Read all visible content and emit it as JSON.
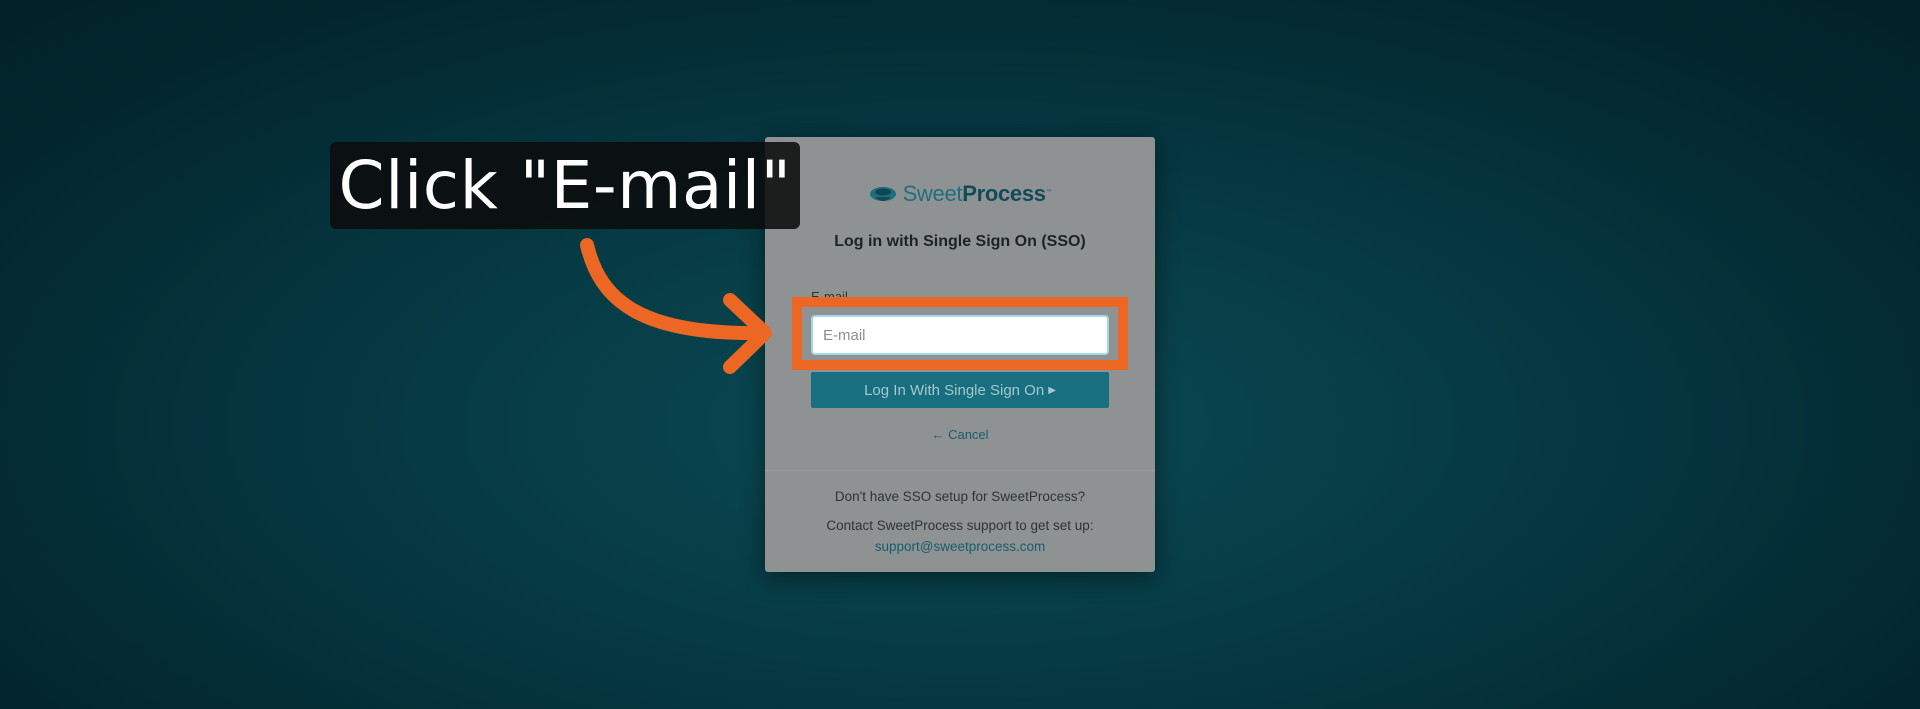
{
  "colors": {
    "accent_orange": "#ec6624",
    "brand_teal": "#176f80",
    "brand_dark": "#114b58",
    "background": "#063a44"
  },
  "callout": {
    "text": "Click \"E-mail\""
  },
  "login_card": {
    "logo": {
      "icon": "teacup-logo-icon",
      "sweet": "Sweet",
      "process": "Process",
      "tm": "™"
    },
    "title": "Log in with Single Sign On (SSO)",
    "email_label": "E-mail",
    "email_placeholder": "E-mail",
    "sso_button": "Log In With Single Sign On",
    "cancel": "Cancel",
    "footer_question": "Don't have SSO setup for SweetProcess?",
    "footer_contact": "Contact SweetProcess support to get set up:",
    "support_email": "support@sweetprocess.com"
  }
}
